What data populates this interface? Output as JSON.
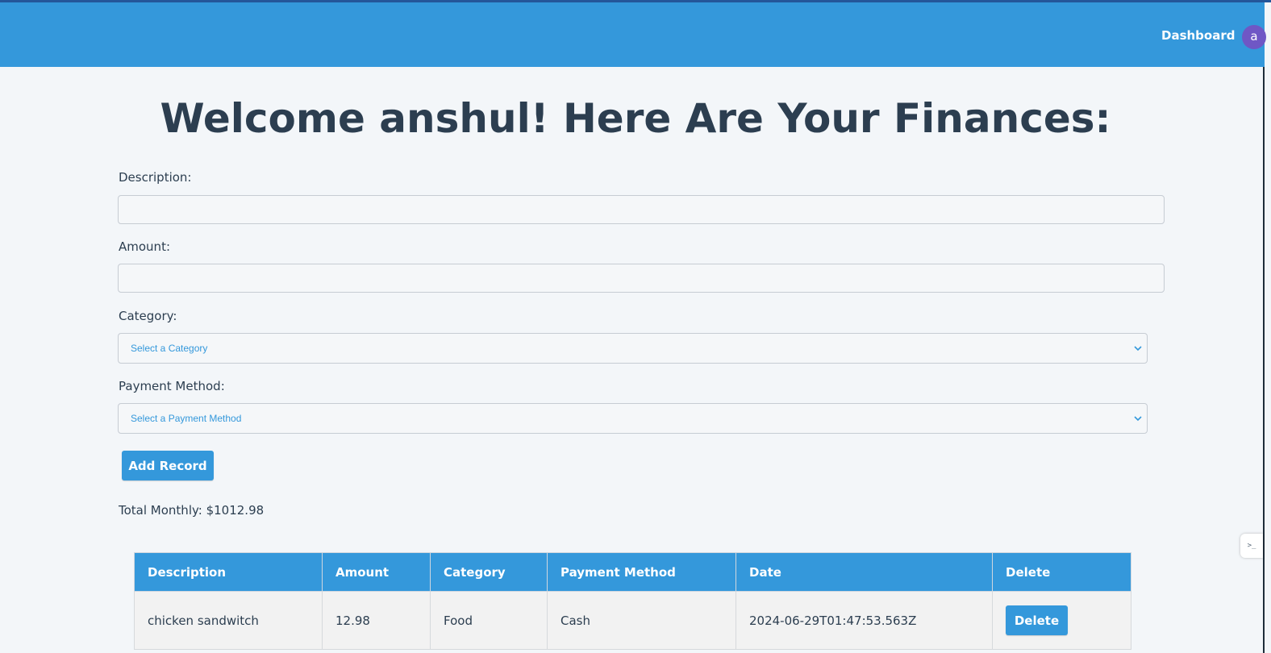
{
  "nav": {
    "dashboard_label": "Dashboard",
    "avatar_initial": "a"
  },
  "page": {
    "title": "Welcome anshul! Here Are Your Finances:"
  },
  "form": {
    "description_label": "Description:",
    "description_value": "",
    "amount_label": "Amount:",
    "amount_value": "",
    "category_label": "Category:",
    "category_selected": "Select a Category",
    "payment_label": "Payment Method:",
    "payment_selected": "Select a Payment Method",
    "submit_label": "Add Record"
  },
  "summary": {
    "total_monthly": "Total Monthly: $1012.98"
  },
  "table": {
    "headers": [
      "Description",
      "Amount",
      "Category",
      "Payment Method",
      "Date",
      "Delete"
    ],
    "rows": [
      {
        "description": "chicken sandwitch",
        "amount": "12.98",
        "category": "Food",
        "payment_method": "Cash",
        "date": "2024-06-29T01:47:53.563Z",
        "delete_label": "Delete"
      }
    ]
  },
  "colors": {
    "primary": "#3498db",
    "heading": "#2c3e50",
    "avatar": "#6f57c5"
  }
}
